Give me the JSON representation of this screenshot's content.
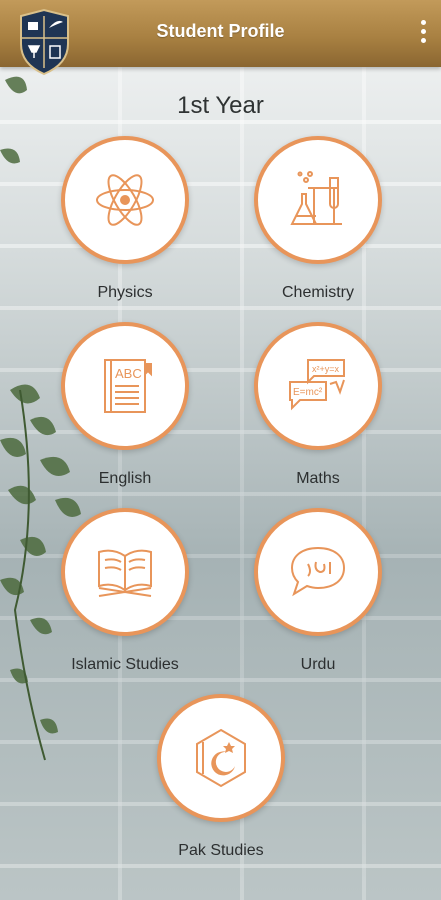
{
  "header": {
    "title": "Student Profile"
  },
  "year_title": "1st Year",
  "subjects": [
    {
      "label": "Physics",
      "icon": "atom-icon"
    },
    {
      "label": "Chemistry",
      "icon": "lab-flask-icon"
    },
    {
      "label": "English",
      "icon": "abc-book-icon"
    },
    {
      "label": "Maths",
      "icon": "formula-bubbles-icon"
    },
    {
      "label": "Islamic Studies",
      "icon": "quran-icon"
    },
    {
      "label": "Urdu",
      "icon": "urdu-speech-bubble-icon"
    },
    {
      "label": "Pak Studies",
      "icon": "crescent-star-icon"
    }
  ],
  "colors": {
    "accent": "#e8955a",
    "header": "#a98142"
  }
}
